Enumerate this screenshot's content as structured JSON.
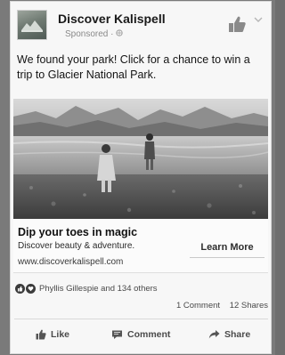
{
  "post": {
    "page_name": "Discover Kalispell",
    "sponsored_label": "Sponsored",
    "text": "We found your park! Click for a chance to win a trip to Glacier National Park."
  },
  "link": {
    "headline": "Dip your toes in magic",
    "description": "Discover beauty & adventure.",
    "domain": "www.discoverkalispell.com",
    "cta_label": "Learn More"
  },
  "engagement": {
    "reactions_text": "Phyllis Gillespie and 134 others",
    "comments": "1 Comment",
    "shares": "12 Shares"
  },
  "actions": {
    "like": "Like",
    "comment": "Comment",
    "share": "Share"
  },
  "icons": {
    "like_button_icon": "thumbs-up-icon",
    "menu_icon": "chevron-down-icon",
    "audience_icon": "globe-icon"
  }
}
